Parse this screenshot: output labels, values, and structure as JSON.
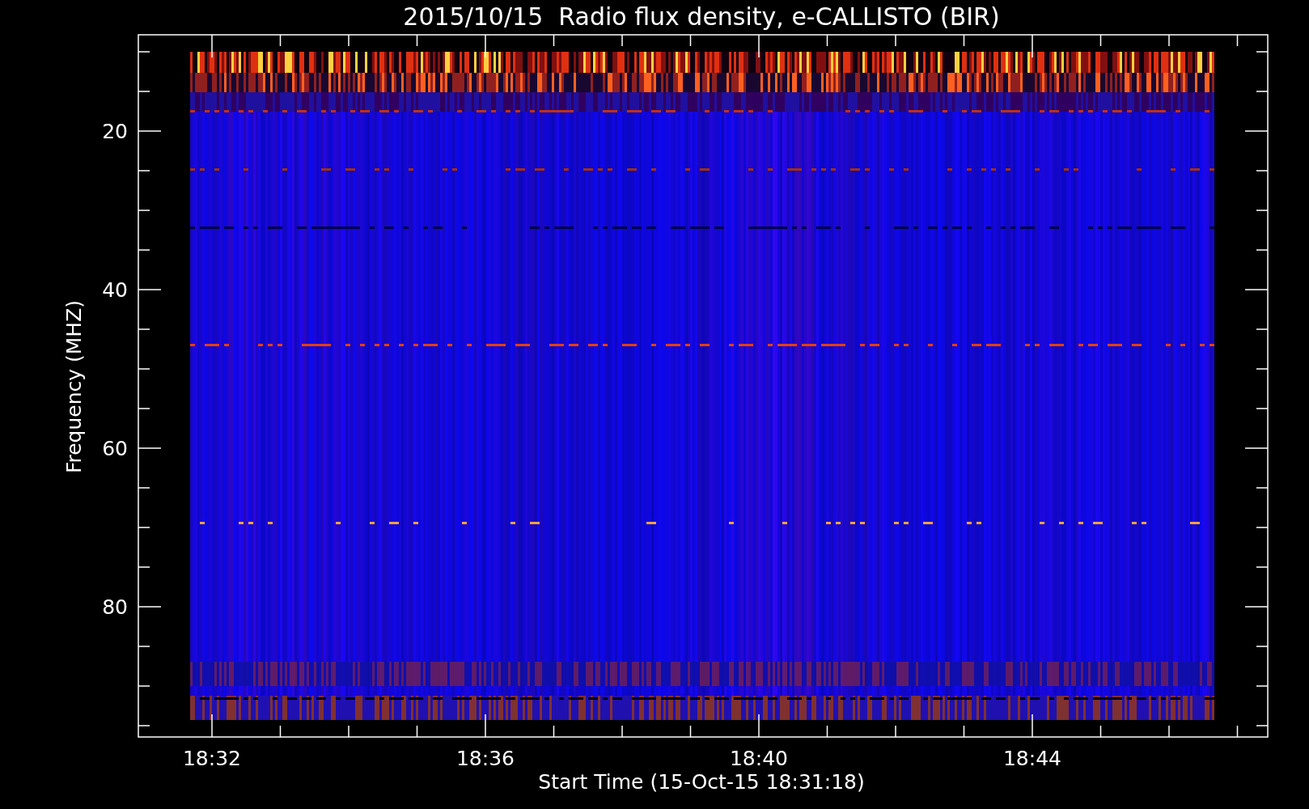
{
  "title": "2015/10/15  Radio flux density, e-CALLISTO (BIR)",
  "y_axis": {
    "label": "Frequency (MHZ)",
    "ticks": [
      "20",
      "40",
      "60",
      "80"
    ]
  },
  "x_axis": {
    "label": "Start Time (15-Oct-15 18:31:18)",
    "ticks": [
      "18:32",
      "18:36",
      "18:40",
      "18:44"
    ]
  }
}
